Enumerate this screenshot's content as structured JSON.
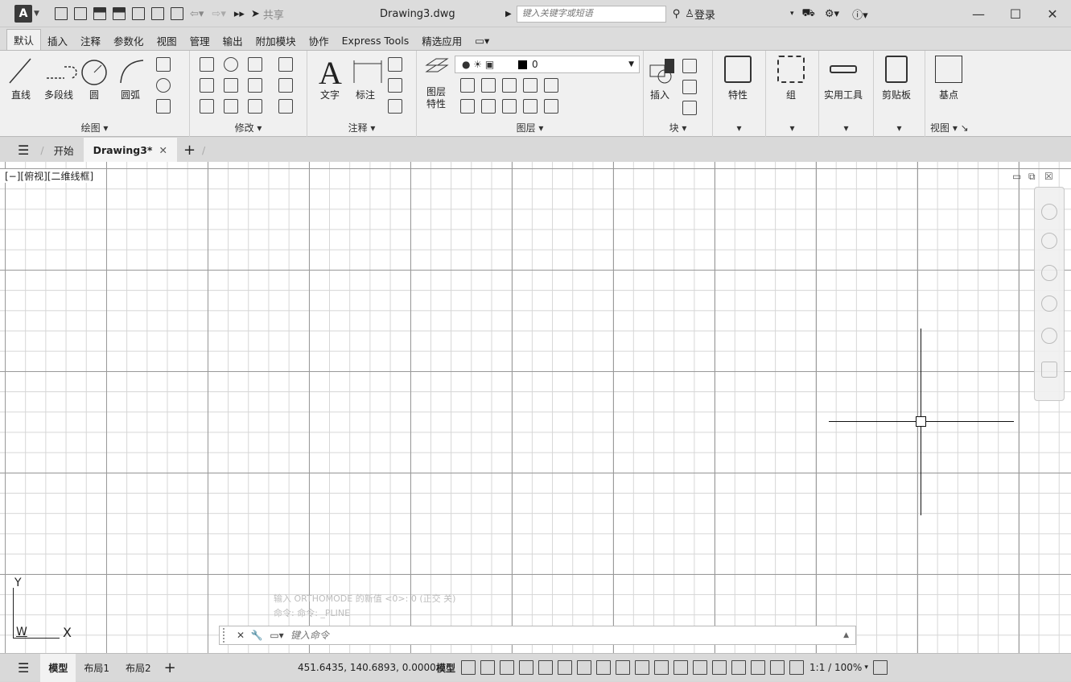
{
  "titlebar": {
    "app_letter": "A",
    "share_label": "共享",
    "document": "Drawing3.dwg",
    "search_placeholder": "键入关键字或短语",
    "login_label": "登录"
  },
  "ribbon_tabs": [
    "默认",
    "插入",
    "注释",
    "参数化",
    "视图",
    "管理",
    "输出",
    "附加模块",
    "协作",
    "Express Tools",
    "精选应用"
  ],
  "ribbon": {
    "draw": {
      "line": "直线",
      "polyline": "多段线",
      "circle": "圆",
      "arc": "圆弧",
      "title": "绘图"
    },
    "modify": {
      "title": "修改"
    },
    "annotation": {
      "text": "文字",
      "dimension": "标注",
      "title": "注释"
    },
    "layers": {
      "layer_props": "图层\n特性",
      "current_layer": "0",
      "title": "图层"
    },
    "block": {
      "insert": "插入",
      "title": "块"
    },
    "properties": {
      "label": "特性"
    },
    "groups": {
      "label": "组"
    },
    "utilities": {
      "label": "实用工具"
    },
    "clipboard": {
      "label": "剪贴板"
    },
    "view": {
      "basepoint": "基点",
      "title": "视图"
    }
  },
  "file_tabs": {
    "start": "开始",
    "drawing": "Drawing3*"
  },
  "viewport": {
    "label": "[−][俯视][二维线框]"
  },
  "ucs": {
    "y": "Y",
    "x": "X",
    "w": "W"
  },
  "command": {
    "placeholder": "键入命令",
    "history_line1": "输入 ORTHOMODE 的新值 <0>: 0 (正交 关)",
    "history_line2": "命令: 命令: _PLINE"
  },
  "statusbar": {
    "tabs": [
      "模型",
      "布局1",
      "布局2"
    ],
    "coords": "451.6435, 140.6893, 0.0000",
    "mode": "模型",
    "scale": "1:1 / 100%"
  }
}
